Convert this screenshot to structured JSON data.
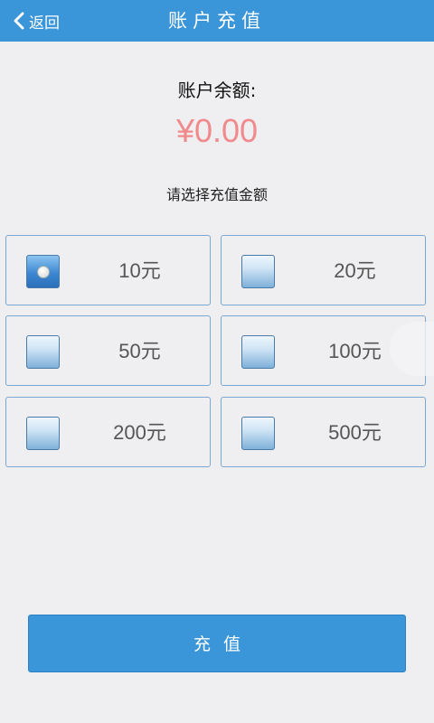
{
  "header": {
    "back_label": "返回",
    "title": "账户充值"
  },
  "balance": {
    "label": "账户余额:",
    "amount": "¥0.00"
  },
  "select_label": "请选择充值金额",
  "options": [
    {
      "label": "10元",
      "checked": true
    },
    {
      "label": "20元",
      "checked": false
    },
    {
      "label": "50元",
      "checked": false
    },
    {
      "label": "100元",
      "checked": false
    },
    {
      "label": "200元",
      "checked": false
    },
    {
      "label": "500元",
      "checked": false
    }
  ],
  "submit_label": "充值",
  "colors": {
    "header_bg": "#3a95d9",
    "amount": "#f08a8c",
    "border": "#7aa8d2",
    "page_bg": "#efeff1"
  }
}
